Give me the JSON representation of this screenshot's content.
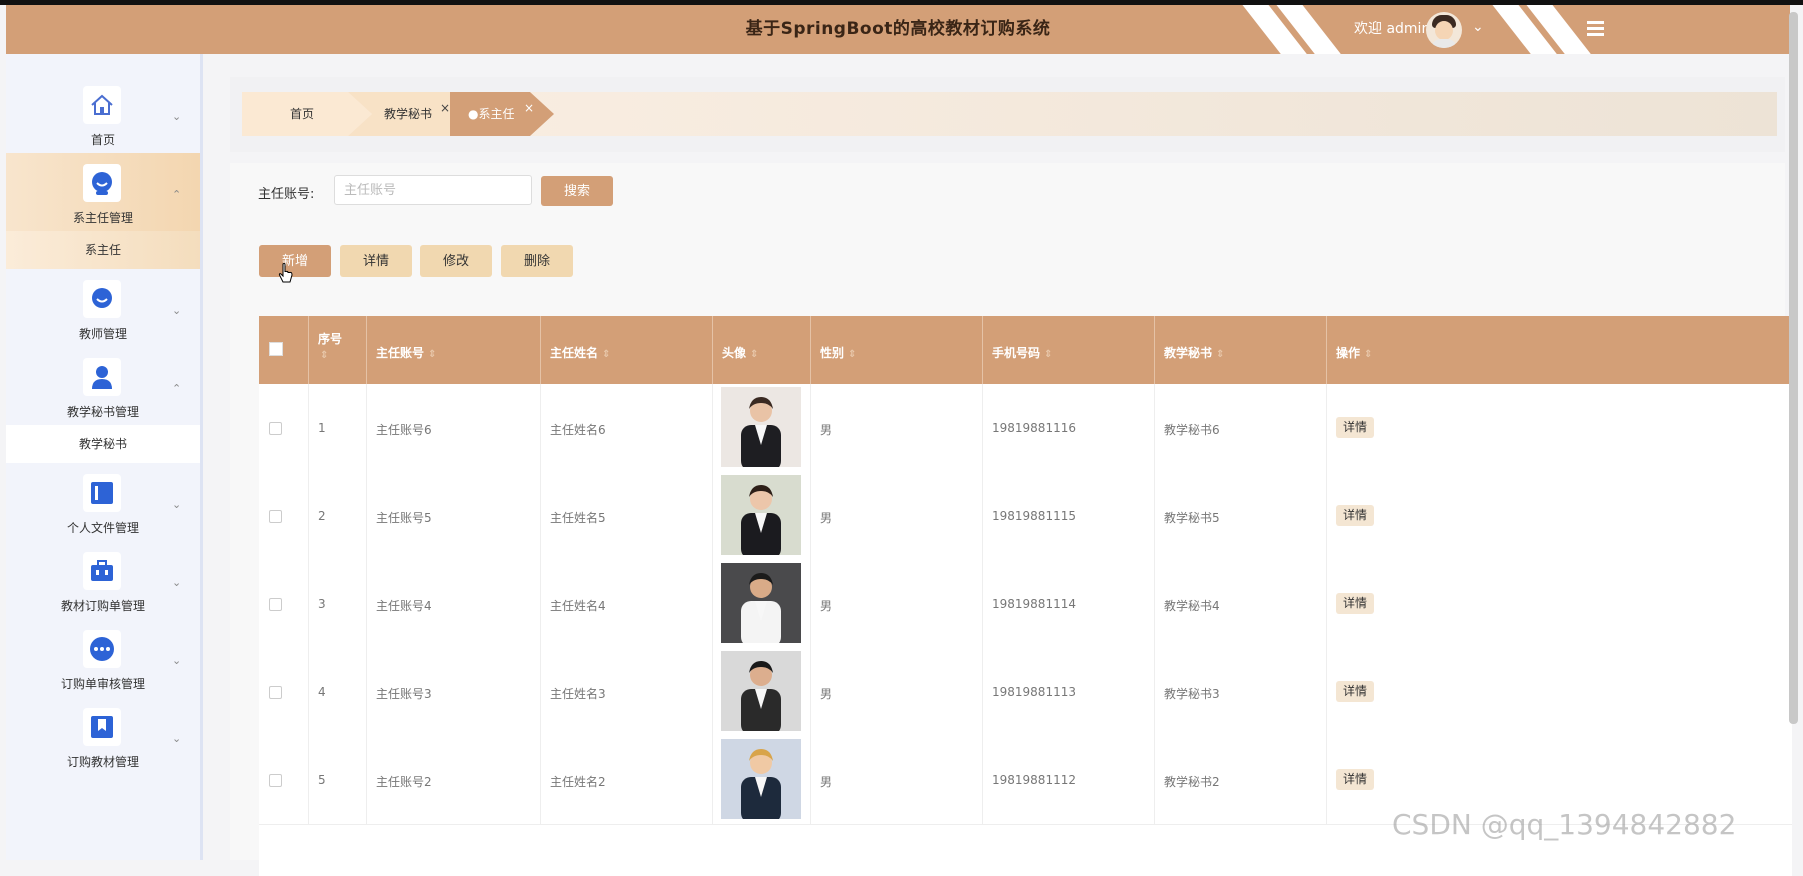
{
  "header": {
    "title": "基于SpringBoot的高校教材订购系统",
    "welcome": "欢迎 admin",
    "accent_color": "#d39f77",
    "icons": [
      "avatar",
      "chevron-down-icon",
      "menu-toggle-icon"
    ]
  },
  "sidebar": {
    "items": [
      {
        "label": "首页",
        "icon": "home-icon"
      },
      {
        "label": "系主任管理",
        "icon": "user-face-icon",
        "sub": "系主任"
      },
      {
        "label": "教师管理",
        "icon": "user-face-icon"
      },
      {
        "label": "教学秘书管理",
        "icon": "person-icon",
        "sub": "教学秘书"
      },
      {
        "label": "个人文件管理",
        "icon": "file-icon"
      },
      {
        "label": "教材订购单管理",
        "icon": "briefcase-icon"
      },
      {
        "label": "订购单审核管理",
        "icon": "dots-icon"
      },
      {
        "label": "订购教材管理",
        "icon": "bookmark-icon"
      }
    ]
  },
  "tabs": [
    {
      "label": "首页"
    },
    {
      "label": "教学秘书",
      "close": "×"
    },
    {
      "label": "●系主任",
      "close": "×"
    }
  ],
  "search": {
    "label": "主任账号:",
    "placeholder": "主任账号",
    "value": "",
    "button": "搜索"
  },
  "actions": {
    "add": "新增",
    "detail": "详情",
    "edit": "修改",
    "delete": "删除"
  },
  "table": {
    "columns": [
      "序号",
      "主任账号",
      "主任姓名",
      "头像",
      "性别",
      "手机号码",
      "教学秘书",
      "操作"
    ],
    "sort_icon": "⇕",
    "rows": [
      {
        "index": "1",
        "account": "主任账号6",
        "name": "主任姓名6",
        "gender": "男",
        "phone": "19819881116",
        "secretary": "教学秘书6",
        "action": "详情"
      },
      {
        "index": "2",
        "account": "主任账号5",
        "name": "主任姓名5",
        "gender": "男",
        "phone": "19819881115",
        "secretary": "教学秘书5",
        "action": "详情"
      },
      {
        "index": "3",
        "account": "主任账号4",
        "name": "主任姓名4",
        "gender": "男",
        "phone": "19819881114",
        "secretary": "教学秘书4",
        "action": "详情"
      },
      {
        "index": "4",
        "account": "主任账号3",
        "name": "主任姓名3",
        "gender": "男",
        "phone": "19819881113",
        "secretary": "教学秘书3",
        "action": "详情"
      },
      {
        "index": "5",
        "account": "主任账号2",
        "name": "主任姓名2",
        "gender": "男",
        "phone": "19819881112",
        "secretary": "教学秘书2",
        "action": "详情"
      }
    ]
  },
  "watermark": "CSDN @qq_1394842882"
}
